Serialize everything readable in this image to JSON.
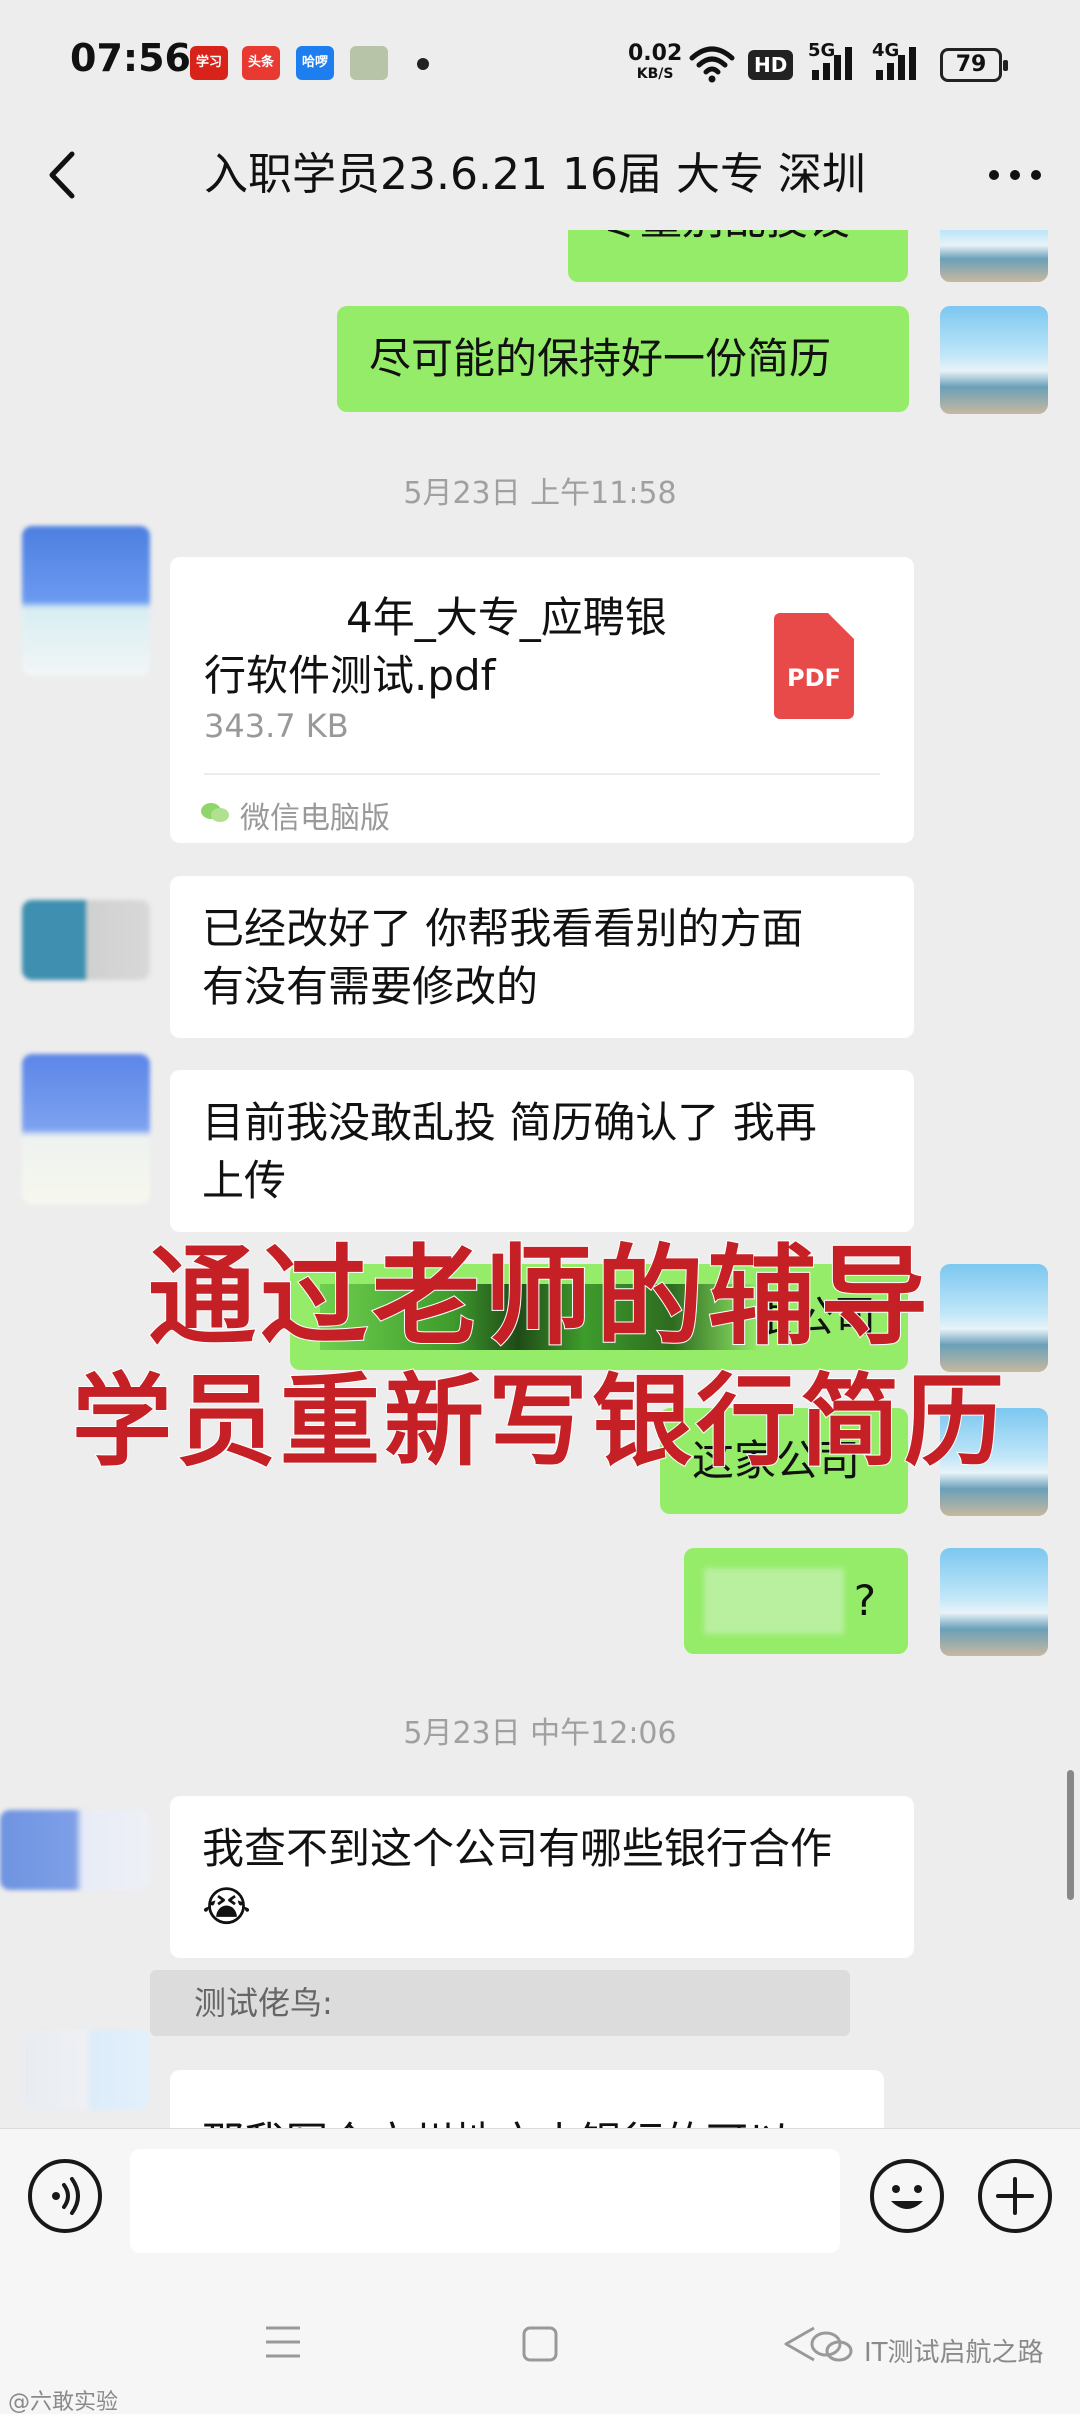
{
  "status_bar": {
    "time": "07:56",
    "apps": [
      {
        "name": "xuexi-app-icon",
        "label": "学习",
        "color": "#d8231a"
      },
      {
        "name": "toutiao-app-icon",
        "label": "头条",
        "color": "#e83a30"
      },
      {
        "name": "hello-app-icon",
        "label": "哈啰",
        "color": "#1d7ef0"
      },
      {
        "name": "picture-app-icon",
        "label": "",
        "color": "#b8c4a8"
      }
    ],
    "net_speed_value": "0.02",
    "net_speed_unit": "KB/S",
    "hd_label": "HD",
    "signal_1": "5G",
    "signal_2": "4G",
    "battery": "79"
  },
  "header": {
    "title": "入职学员23.6.21 16届 大专 深圳"
  },
  "messages": {
    "partial_top": "尽量别乱投设",
    "msg1": "尽可能的保持好一份简历",
    "timestamp1": "5月23日 上午11:58",
    "file": {
      "name_line1": "4年_大专_应聘银",
      "name_line2": "行软件测试.pdf",
      "size": "343.7 KB",
      "icon_label": "PDF",
      "source": "微信电脑版"
    },
    "msg2_line1": "已经改好了 你帮我看看别的方面",
    "msg2_line2": "有没有需要修改的",
    "msg3_line1": "目前我没敢乱投 简历确认了 我再",
    "msg3_line2": "上传",
    "msg4_partial": "银公司",
    "msg5": "这家公司",
    "msg6_partial": "?",
    "timestamp2": "5月23日 中午12:06",
    "msg7": "我查不到这个公司有哪些银行合作",
    "msg7_emoji": "😭",
    "quote_name": "测试佬鸟:",
    "msg8_partial": "那我写个广州地方小银行的可以"
  },
  "overlay": {
    "line1": "通过老师的辅导",
    "line2": "学员重新写银行简历"
  },
  "watermarks": {
    "left": "@六敢实验",
    "right": "IT测试启航之路"
  },
  "colors": {
    "my_bubble": "#95ec69",
    "other_bubble": "#ffffff",
    "background": "#ededed",
    "overlay_text": "#c42026",
    "pdf_red": "#e84a4a"
  }
}
